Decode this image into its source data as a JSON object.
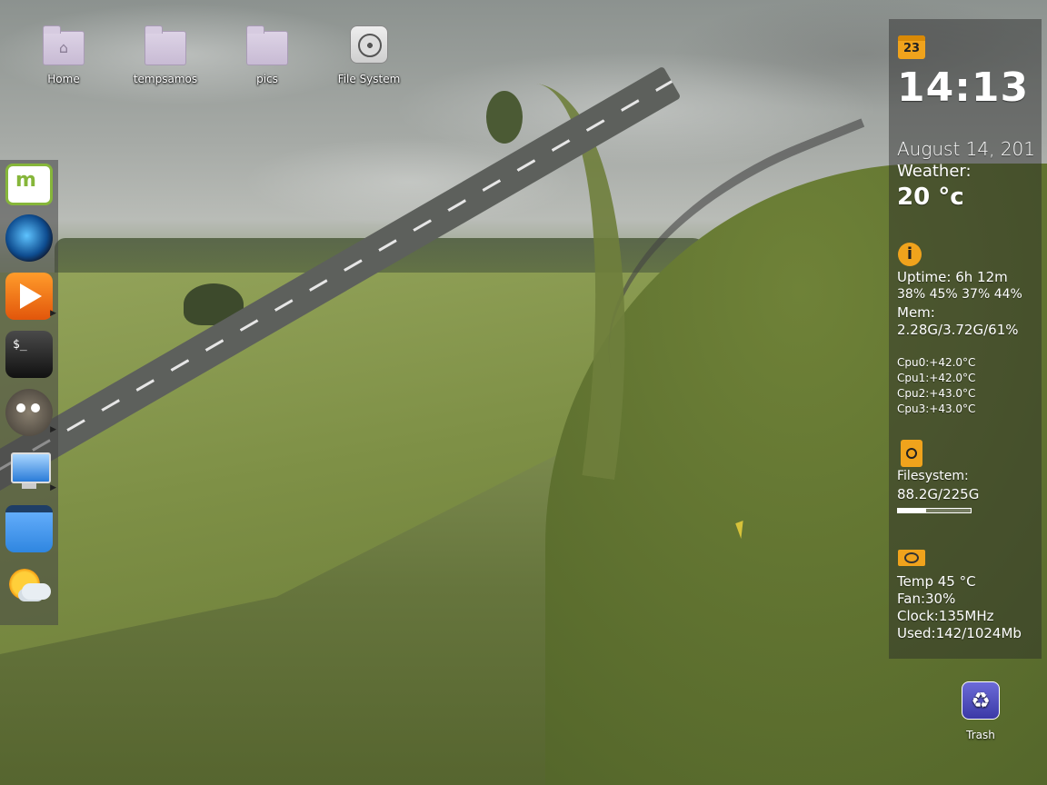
{
  "desktop_icons": [
    {
      "label": "Home",
      "icon": "home-folder-icon"
    },
    {
      "label": "tempsamos",
      "icon": "folder-icon"
    },
    {
      "label": "pics",
      "icon": "folder-icon"
    },
    {
      "label": "File System",
      "icon": "drive-icon"
    }
  ],
  "dock": {
    "items": [
      {
        "app": "linux-mint-menu",
        "icon": "mint-logo-icon"
      },
      {
        "app": "thunderbird",
        "icon": "thunderbird-icon"
      },
      {
        "app": "vlc",
        "icon": "play-icon"
      },
      {
        "app": "terminal",
        "icon": "terminal-icon",
        "glyph": "$_"
      },
      {
        "app": "gimp",
        "icon": "gimp-icon"
      },
      {
        "app": "display",
        "icon": "monitor-icon"
      },
      {
        "app": "files",
        "icon": "files-icon"
      },
      {
        "app": "weather",
        "icon": "weather-icon"
      }
    ]
  },
  "conky": {
    "calendar_day": "23",
    "time": "14:13",
    "date": "August 14, 201",
    "weather_label": "Weather:",
    "temperature": "20 °c",
    "info_glyph": "i",
    "uptime": "Uptime: 6h 12m",
    "cpu_usage": " 38% 45% 37% 44%",
    "mem_label": "Mem:",
    "mem_value": "2.28G/3.72G/61%",
    "cpu_temps": [
      "Cpu0:+42.0°C",
      "Cpu1:+42.0°C",
      "Cpu2:+43.0°C",
      "Cpu3:+43.0°C"
    ],
    "fs_label": "Filesystem:",
    "fs_value": "88.2G/225G",
    "fs_used_fraction": 0.39,
    "gpu_temp": "Temp 45 °C",
    "gpu_fan": "Fan:30%",
    "gpu_clock": "Clock:135MHz",
    "gpu_mem": "Used:142/1024Mb"
  },
  "trash": {
    "label": "Trash",
    "glyph": "♻"
  },
  "colors": {
    "accent": "#f0a31c",
    "panel_bg": "rgba(40,40,40,.45)"
  }
}
